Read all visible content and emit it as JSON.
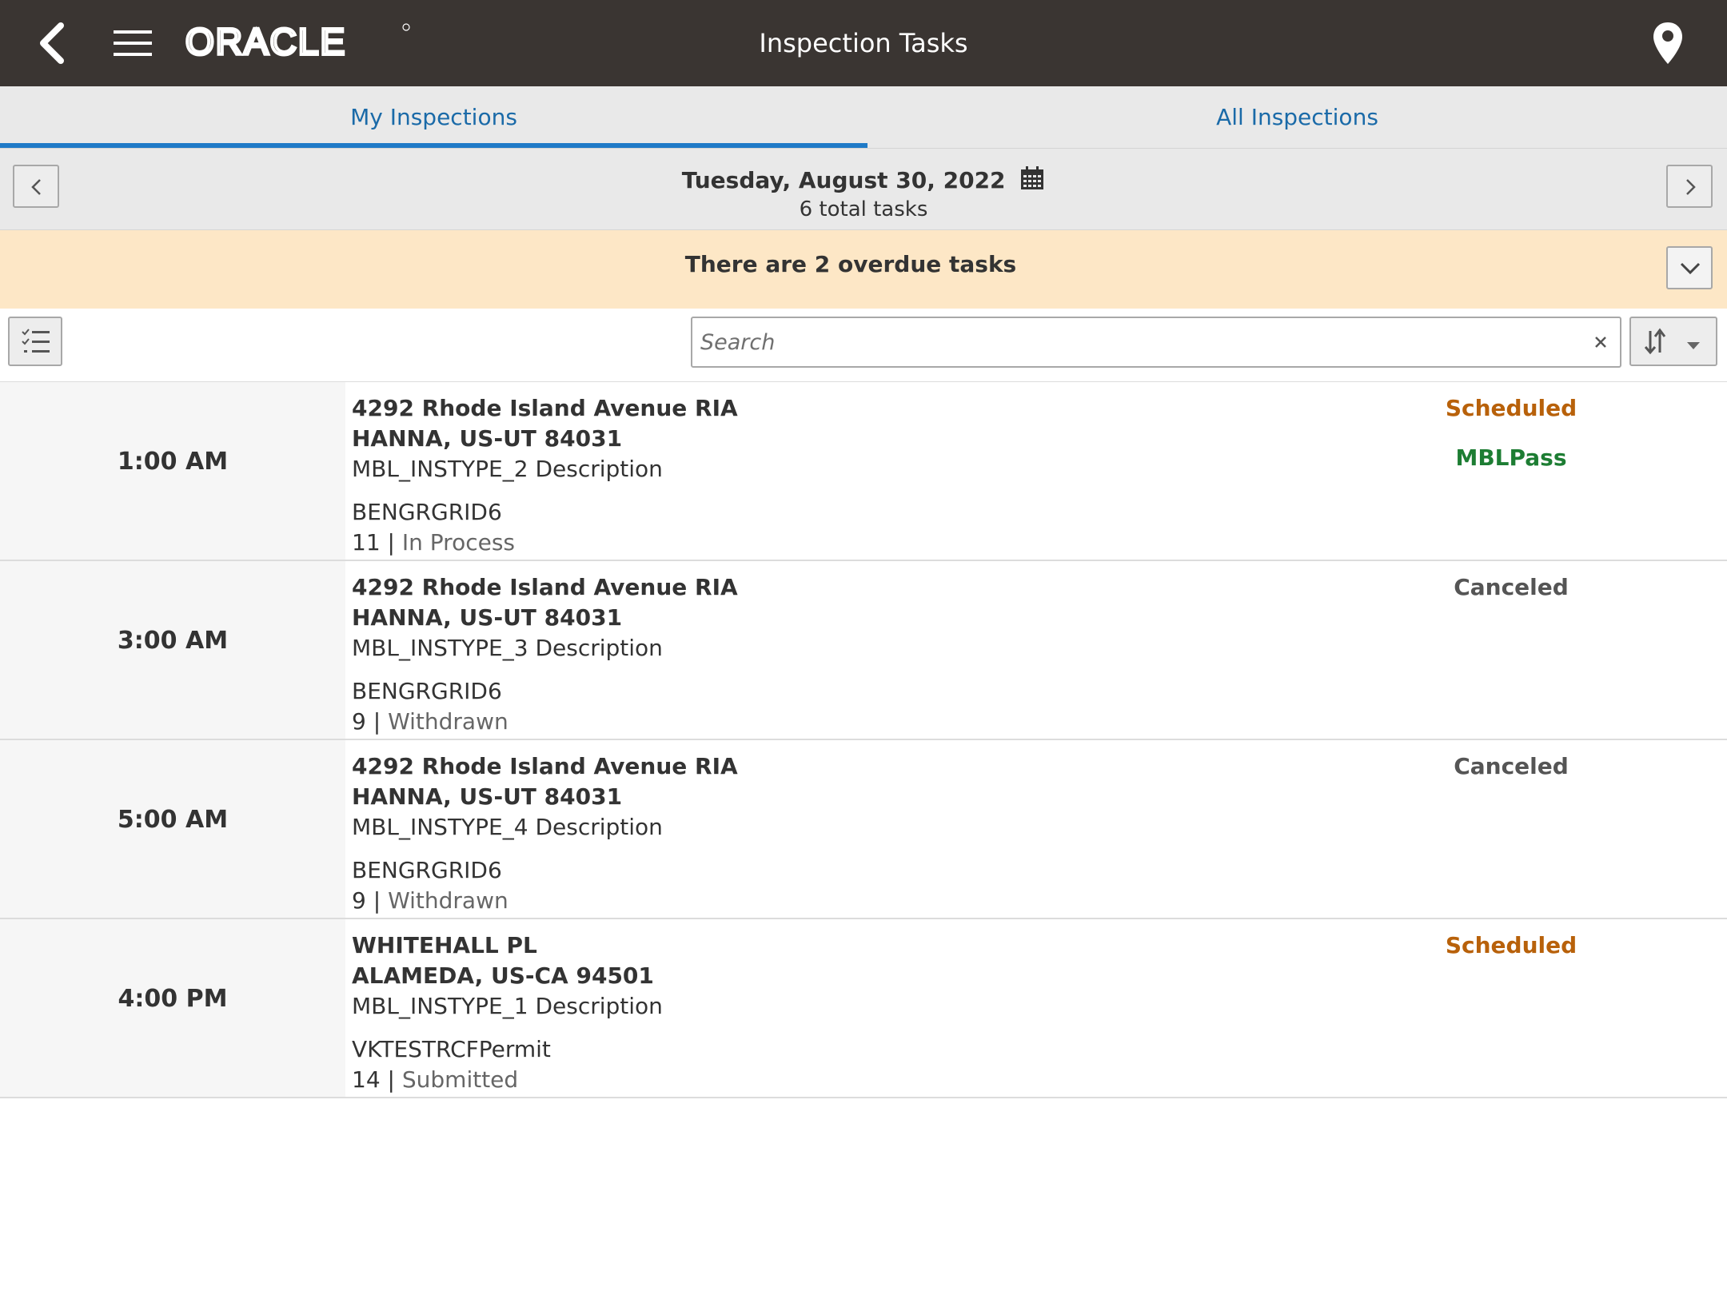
{
  "header": {
    "title": "Inspection Tasks",
    "logo_text": "ORACLE",
    "back_icon": "back-arrow-icon",
    "menu_icon": "hamburger-menu-icon",
    "location_icon": "location-pin-icon"
  },
  "tabs": [
    {
      "label": "My Inspections",
      "active": true
    },
    {
      "label": "All Inspections",
      "active": false
    }
  ],
  "datebar": {
    "date": "Tuesday, August 30, 2022",
    "total": "6 total tasks"
  },
  "overdue": {
    "text": "There are 2 overdue tasks"
  },
  "search": {
    "placeholder": "Search",
    "value": ""
  },
  "colors": {
    "header_bg": "#3a3532",
    "accent_blue": "#1f7ac7",
    "scheduled": "#b8610a",
    "canceled": "#555555",
    "pass": "#1d7d33",
    "overdue_bg": "#fde7c6"
  },
  "tasks": [
    {
      "time": "1:00 AM",
      "address1": "4292 Rhode Island Avenue RIA",
      "address2": "HANNA, US-UT 84031",
      "description": "MBL_INSTYPE_2 Description",
      "permit": "BENGRGRID6",
      "number": "11 | ",
      "status_text": "In Process",
      "badge": "Scheduled",
      "badge_color": "#b8610a",
      "result": "MBLPass",
      "result_color": "#1d7d33"
    },
    {
      "time": "3:00 AM",
      "address1": "4292 Rhode Island Avenue RIA",
      "address2": "HANNA, US-UT 84031",
      "description": "MBL_INSTYPE_3 Description",
      "permit": "BENGRGRID6",
      "number": "9 | ",
      "status_text": "Withdrawn",
      "badge": "Canceled",
      "badge_color": "#555555",
      "result": "",
      "result_color": ""
    },
    {
      "time": "5:00 AM",
      "address1": "4292 Rhode Island Avenue RIA",
      "address2": "HANNA, US-UT 84031",
      "description": "MBL_INSTYPE_4 Description",
      "permit": "BENGRGRID6",
      "number": "9 | ",
      "status_text": "Withdrawn",
      "badge": "Canceled",
      "badge_color": "#555555",
      "result": "",
      "result_color": ""
    },
    {
      "time": "4:00 PM",
      "address1": "WHITEHALL PL",
      "address2": "ALAMEDA, US-CA 94501",
      "description": "MBL_INSTYPE_1 Description",
      "permit": "VKTESTRCFPermit",
      "number": "14 | ",
      "status_text": "Submitted",
      "badge": "Scheduled",
      "badge_color": "#b8610a",
      "result": "",
      "result_color": ""
    }
  ]
}
